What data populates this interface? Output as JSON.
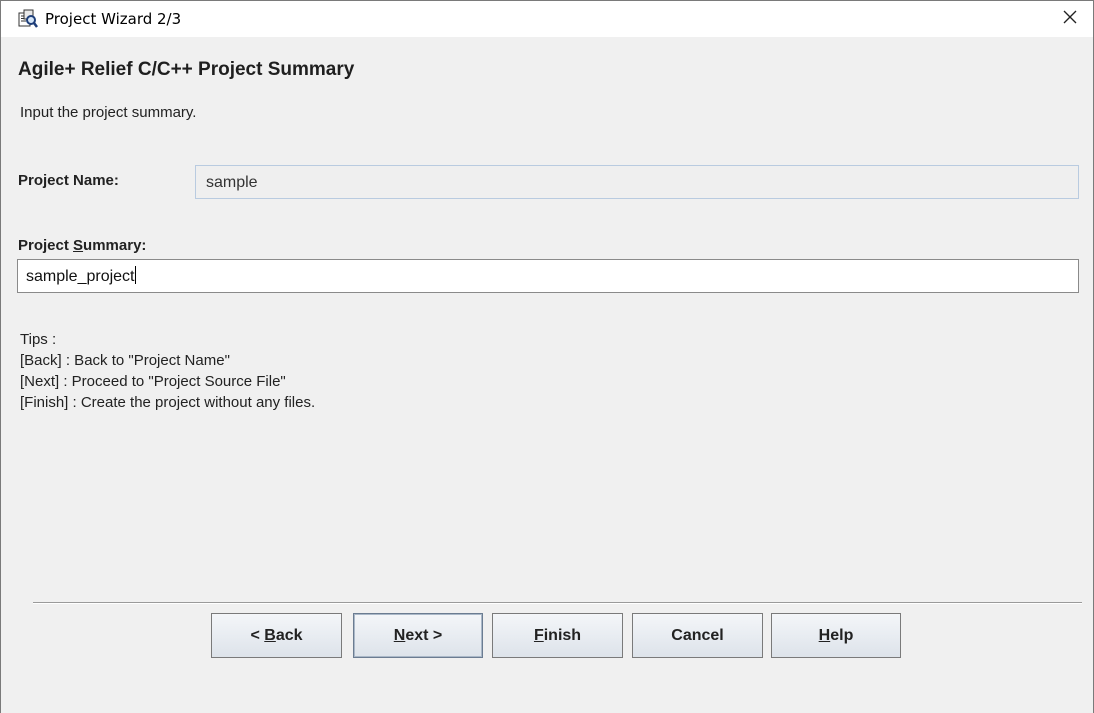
{
  "window": {
    "title": "Project Wizard 2/3"
  },
  "header": {
    "heading": "Agile+ Relief C/C++ Project Summary",
    "description": "Input the project summary."
  },
  "form": {
    "project_name_label": "Project Name:",
    "project_name_value": "sample",
    "project_summary_label_prefix": "Project ",
    "project_summary_label_mnemonic": "S",
    "project_summary_label_suffix": "ummary:",
    "project_summary_value": "sample_project"
  },
  "tips": {
    "title": "Tips :",
    "lines": [
      "[Back] : Back to \"Project Name\"",
      "[Next] : Proceed to \"Project Source File\"",
      "[Finish] : Create the project without any files."
    ]
  },
  "buttons": {
    "back": {
      "prefix": "< ",
      "mnemonic": "B",
      "suffix": "ack"
    },
    "next": {
      "prefix": "",
      "mnemonic": "N",
      "suffix": "ext >"
    },
    "finish": {
      "prefix": "",
      "mnemonic": "F",
      "suffix": "inish"
    },
    "cancel": {
      "label": "Cancel"
    },
    "help": {
      "prefix": "",
      "mnemonic": "H",
      "suffix": "elp"
    }
  },
  "icons": {
    "title_icon": "wizard-app-icon",
    "close_icon": "close-icon"
  }
}
